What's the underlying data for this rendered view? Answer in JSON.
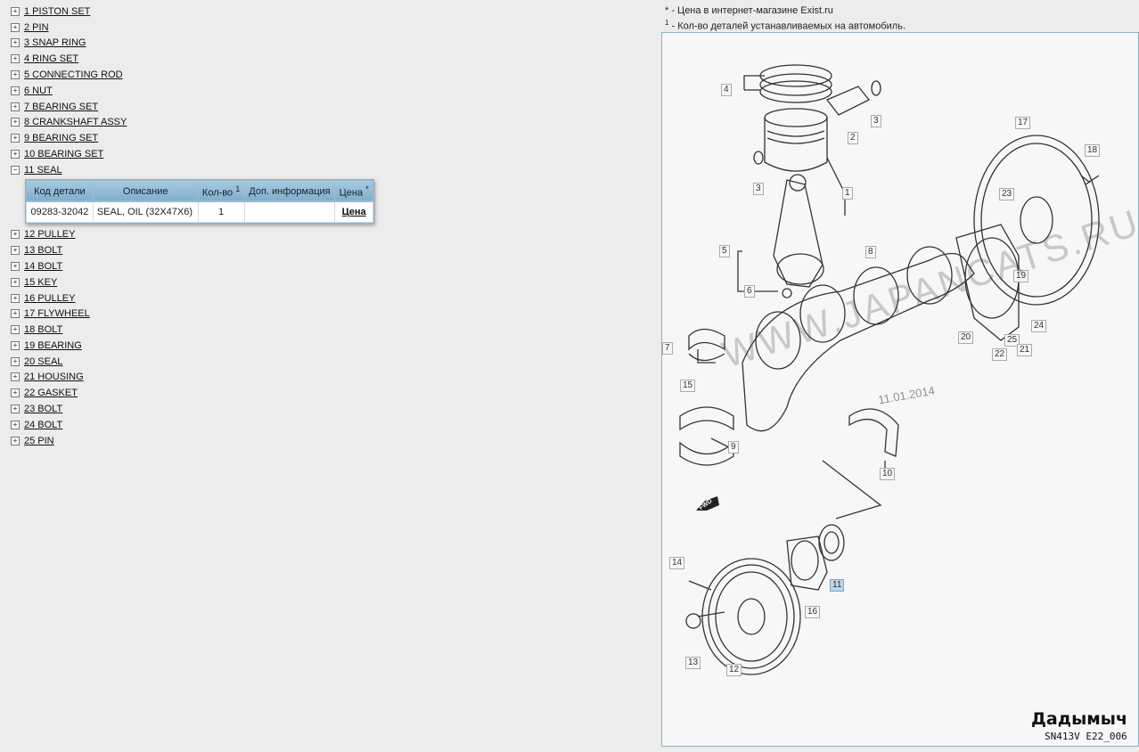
{
  "tree": {
    "items_before": [
      {
        "expander": "+",
        "label": "1 PISTON SET"
      },
      {
        "expander": "+",
        "label": "2 PIN"
      },
      {
        "expander": "+",
        "label": "3 SNAP RING"
      },
      {
        "expander": "+",
        "label": "4 RING SET"
      },
      {
        "expander": "+",
        "label": "5 CONNECTING ROD"
      },
      {
        "expander": "+",
        "label": "6 NUT"
      },
      {
        "expander": "+",
        "label": "7 BEARING SET"
      },
      {
        "expander": "+",
        "label": "8 CRANKSHAFT ASSY"
      },
      {
        "expander": "+",
        "label": "9 BEARING SET"
      },
      {
        "expander": "+",
        "label": "10 BEARING SET"
      }
    ],
    "expanded": {
      "expander": "−",
      "label": "11 SEAL"
    },
    "items_after": [
      {
        "expander": "+",
        "label": "12 PULLEY"
      },
      {
        "expander": "+",
        "label": "13 BOLT"
      },
      {
        "expander": "+",
        "label": "14 BOLT"
      },
      {
        "expander": "+",
        "label": "15 KEY"
      },
      {
        "expander": "+",
        "label": "16 PULLEY"
      },
      {
        "expander": "+",
        "label": "17 FLYWHEEL"
      },
      {
        "expander": "+",
        "label": "18 BOLT"
      },
      {
        "expander": "+",
        "label": "19 BEARING"
      },
      {
        "expander": "+",
        "label": "20 SEAL"
      },
      {
        "expander": "+",
        "label": "21 HOUSING"
      },
      {
        "expander": "+",
        "label": "22 GASKET"
      },
      {
        "expander": "+",
        "label": "23 BOLT"
      },
      {
        "expander": "+",
        "label": "24 BOLT"
      },
      {
        "expander": "+",
        "label": "25 PIN"
      }
    ]
  },
  "parts_table": {
    "headers": {
      "code": "Код детали",
      "description": "Описание",
      "qty": "Кол-во",
      "qty_mark": "1",
      "info": "Доп. информация",
      "price": "Цена",
      "price_mark": "*"
    },
    "row": {
      "code": "09283-32042",
      "description": "SEAL, OIL (32X47X6)",
      "qty": "1",
      "info": "",
      "price_link": "Цена"
    }
  },
  "notes": {
    "line1_mark": "*",
    "line1": " - Цена в интернет-магазине Exist.ru",
    "line2_mark": "1",
    "line2": " - Кол-во деталей устанавливаемых на автомобиль."
  },
  "diagram": {
    "callouts": [
      "4",
      "3",
      "2",
      "3",
      "1",
      "5",
      "6",
      "8",
      "17",
      "18",
      "23",
      "19",
      "24",
      "25",
      "20",
      "22",
      "21",
      "7",
      "15",
      "9",
      "10",
      "14",
      "11",
      "16",
      "13",
      "12"
    ],
    "highlighted_callout": "11",
    "watermark": "WWW.JAPANCATS.RU",
    "stamp_date": "11.01.2014",
    "fwd_label": "FWD",
    "signature": "Дадымыч",
    "code": "SN413V E22_006"
  },
  "colors": {
    "accent_header": "#8fb8d2",
    "highlight": "#bcd6ea",
    "background": "#ececec"
  }
}
